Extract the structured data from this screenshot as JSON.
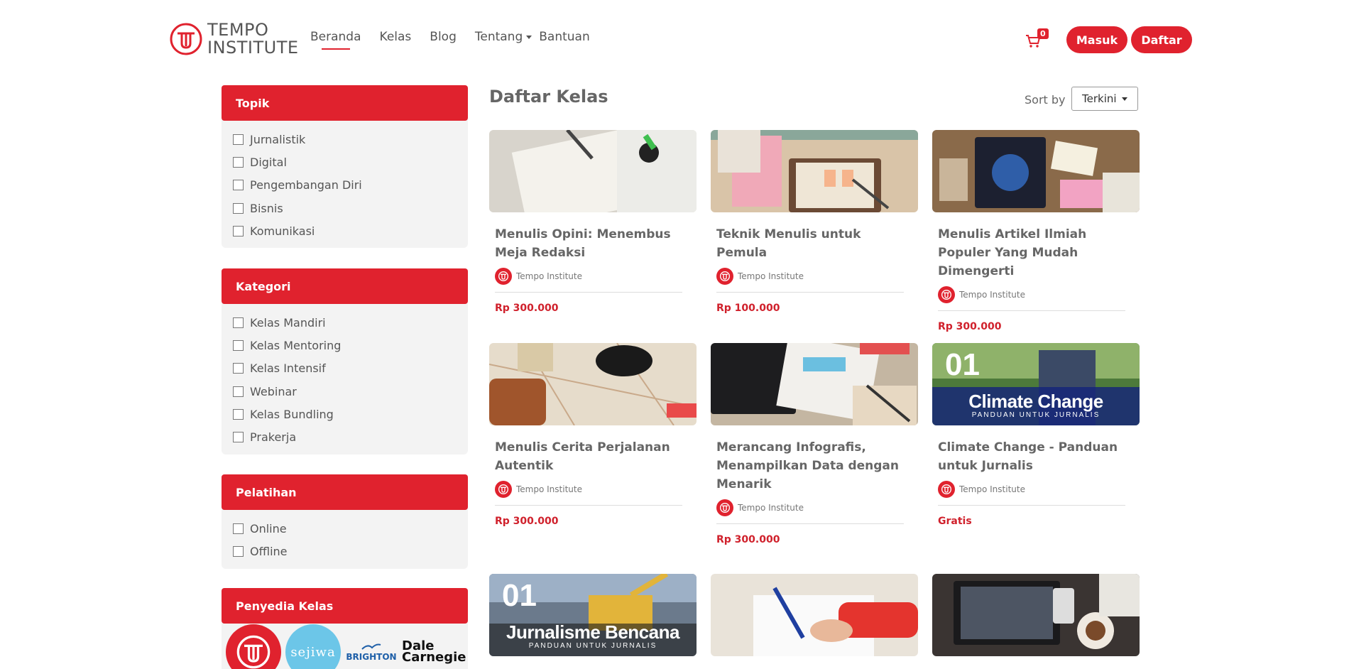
{
  "brand": {
    "line1": "TEMPO",
    "line2": "INSTITUTE"
  },
  "nav": [
    {
      "label": "Beranda"
    },
    {
      "label": "Kelas"
    },
    {
      "label": "Blog"
    },
    {
      "label": "Tentang"
    },
    {
      "label": "Bantuan"
    }
  ],
  "cart": {
    "count": "0"
  },
  "auth": {
    "login": "Masuk",
    "register": "Daftar"
  },
  "sidebar": {
    "topik": {
      "title": "Topik",
      "items": [
        "Jurnalistik",
        "Digital",
        "Pengembangan Diri",
        "Bisnis",
        "Komunikasi"
      ]
    },
    "kategori": {
      "title": "Kategori",
      "items": [
        "Kelas Mandiri",
        "Kelas Mentoring",
        "Kelas Intensif",
        "Webinar",
        "Kelas Bundling",
        "Prakerja"
      ]
    },
    "pelatihan": {
      "title": "Pelatihan",
      "items": [
        "Online",
        "Offline"
      ]
    },
    "penyedia": {
      "title": "Penyedia Kelas",
      "providers": [
        "sejiwa",
        "BRIGHTON",
        "Dale",
        "Carnegie"
      ]
    }
  },
  "main": {
    "title": "Daftar Kelas",
    "sort_label": "Sort by",
    "sort_value": "Terkini"
  },
  "courses": [
    {
      "title": "Menulis Opini: Menembus Meja Redaksi",
      "author": "Tempo Institute",
      "price": "Rp 300.000"
    },
    {
      "title": "Teknik Menulis untuk Pemula",
      "author": "Tempo Institute",
      "price": "Rp 100.000"
    },
    {
      "title": "Menulis Artikel Ilmiah Populer Yang Mudah Dimengerti",
      "author": "Tempo Institute",
      "price": "Rp 300.000"
    },
    {
      "title": "Menulis Cerita Perjalanan Autentik",
      "author": "Tempo Institute",
      "price": "Rp 300.000"
    },
    {
      "title": "Merancang Infografis, Menampilkan Data dengan Menarik",
      "author": "Tempo Institute",
      "price": "Rp 300.000"
    },
    {
      "title": "Climate Change - Panduan untuk Jurnalis",
      "author": "Tempo Institute",
      "price": "Gratis",
      "overlay": {
        "num": "01",
        "big": "Climate Change",
        "small": "PANDUAN UNTUK JURNALIS"
      }
    },
    {
      "overlay": {
        "num": "01",
        "big": "Jurnalisme Bencana",
        "small": "PANDUAN UNTUK JURNALIS"
      }
    },
    {},
    {}
  ],
  "colors": {
    "accent": "#e0222e",
    "price": "#d0212c",
    "sidebar_bg": "#f3f3f3"
  }
}
